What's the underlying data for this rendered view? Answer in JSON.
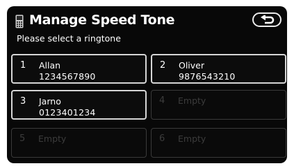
{
  "header": {
    "title": "Manage Speed Tone",
    "subtitle": "Please select a ringtone",
    "icon": "phone-icon"
  },
  "back_button": {
    "icon": "return-arrow-icon"
  },
  "slots": [
    {
      "number": "1",
      "name": "Allan",
      "phone": "1234567890"
    },
    {
      "number": "2",
      "name": "Oliver",
      "phone": "9876543210"
    },
    {
      "number": "3",
      "name": "Jarno",
      "phone": "0123401234"
    },
    {
      "number": "4",
      "name": "Empty",
      "phone": ""
    },
    {
      "number": "5",
      "name": "Empty",
      "phone": ""
    },
    {
      "number": "6",
      "name": "Empty",
      "phone": ""
    }
  ]
}
